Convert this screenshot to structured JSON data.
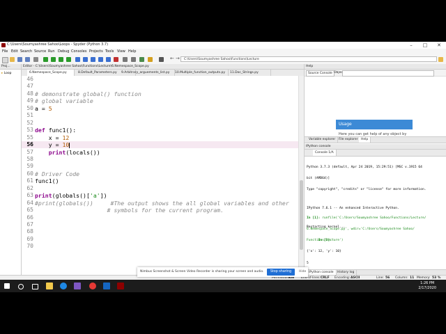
{
  "window": {
    "title": "C:\\Users\\Soumyashree Sahoo\\Loops - Spyder (Python 3.7)"
  },
  "menu": [
    "File",
    "Edit",
    "Search",
    "Source",
    "Run",
    "Debug",
    "Consoles",
    "Projects",
    "Tools",
    "View",
    "Help"
  ],
  "toolbar": {
    "path": "C:\\Users\\Soumyashree Sahoo\\Functions\\Lecture"
  },
  "project_pane": {
    "header": "Proj...",
    "item": "Loop"
  },
  "editor": {
    "header": "Editor - C:\\Users\\Soumyashree Sahoo\\Functions\\Lecture\\6.Nemespace_Scope.py",
    "tabs": [
      "6.Nemespace_Scope.py",
      "8.Default_Parameters.py",
      "9.Arbitrary_arguements_list.py",
      "10.Multiple_function_outputs.py",
      "11.Doc_Strings.py"
    ],
    "lines": [
      {
        "n": "46",
        "t": ""
      },
      {
        "n": "47",
        "t": ""
      },
      {
        "n": "48",
        "t": "# demonstrate global() function"
      },
      {
        "n": "49",
        "t": "# global variable"
      },
      {
        "n": "50",
        "t": "a = 5"
      },
      {
        "n": "51",
        "t": ""
      },
      {
        "n": "52",
        "t": ""
      },
      {
        "n": "53",
        "t": "def func1():"
      },
      {
        "n": "55",
        "t": "    x = 12"
      },
      {
        "n": "56",
        "t": "    y = 10"
      },
      {
        "n": "57",
        "t": "    print(locals())"
      },
      {
        "n": "58",
        "t": ""
      },
      {
        "n": "59",
        "t": ""
      },
      {
        "n": "60",
        "t": "# Driver Code"
      },
      {
        "n": "61",
        "t": "func1()"
      },
      {
        "n": "62",
        "t": ""
      },
      {
        "n": "63",
        "t": "print(globals()['a'])"
      },
      {
        "n": "64",
        "t": "#print(globals())     #The output shows the all global variables and other"
      },
      {
        "n": "65",
        "t": "                     # symbols for the current program."
      },
      {
        "n": "66",
        "t": ""
      },
      {
        "n": "67",
        "t": ""
      },
      {
        "n": "68",
        "t": ""
      },
      {
        "n": "69",
        "t": ""
      },
      {
        "n": "70",
        "t": ""
      }
    ],
    "current_line": "56"
  },
  "help": {
    "header": "Help",
    "source_label": "Source Console",
    "object_label": "Object",
    "usage_title": "Usage",
    "usage_text": "Here you can get help of any object by",
    "tabs": [
      "Variable explorer",
      "File explorer",
      "Help"
    ]
  },
  "console": {
    "header": "IPython console",
    "tab": "Console 1/A",
    "banner": [
      "Python 3.7.3 (default, Apr 24 2019, 15:29:51) [MSC v.1915 64",
      "bit (AMD64)]",
      "Type \"copyright\", \"credits\" or \"license\" for more information.",
      "",
      "IPython 7.6.1 -- An enhanced Interactive Python.",
      "",
      "Restarting kernel..."
    ],
    "in1_prompt": "In [1]:",
    "in1_cmd": [
      "runfile('C:/Users/Soumyashree Sahoo/Functions/Lecture/",
      "6.Nemespace_Scope.py', wdir='C:/Users/Soumyashree Sahoo/",
      "Functions/Lecture')"
    ],
    "output": [
      "{'x': 12, 'y': 10}",
      "5"
    ],
    "in2_prompt": "In [2]:",
    "bottom_tabs": [
      "IPython console",
      "History log"
    ]
  },
  "status": {
    "permissions_label": "Permissions:",
    "permissions": "RW",
    "eol_label": "End-of-lines:",
    "eol": "CRLF",
    "encoding_label": "Encoding:",
    "encoding": "ASCII",
    "line_label": "Line:",
    "line": "56",
    "column_label": "Column:",
    "column": "11",
    "memory_label": "Memory:",
    "memory": "53 %"
  },
  "share_bar": {
    "text": "Nimbus Screenshot & Screen Video Recorder is sharing your screen and audio.",
    "stop_label": "Stop sharing",
    "hide_label": "Hide"
  },
  "taskbar": {
    "time": "1:26 PM",
    "date": "2/17/2020"
  },
  "colors": {
    "keyword": "#8e0a8e",
    "comment": "#8a8a8a",
    "current_line": "#f6e8f1",
    "usage": "#3c8ad6",
    "share_button": "#1f6ed4"
  }
}
